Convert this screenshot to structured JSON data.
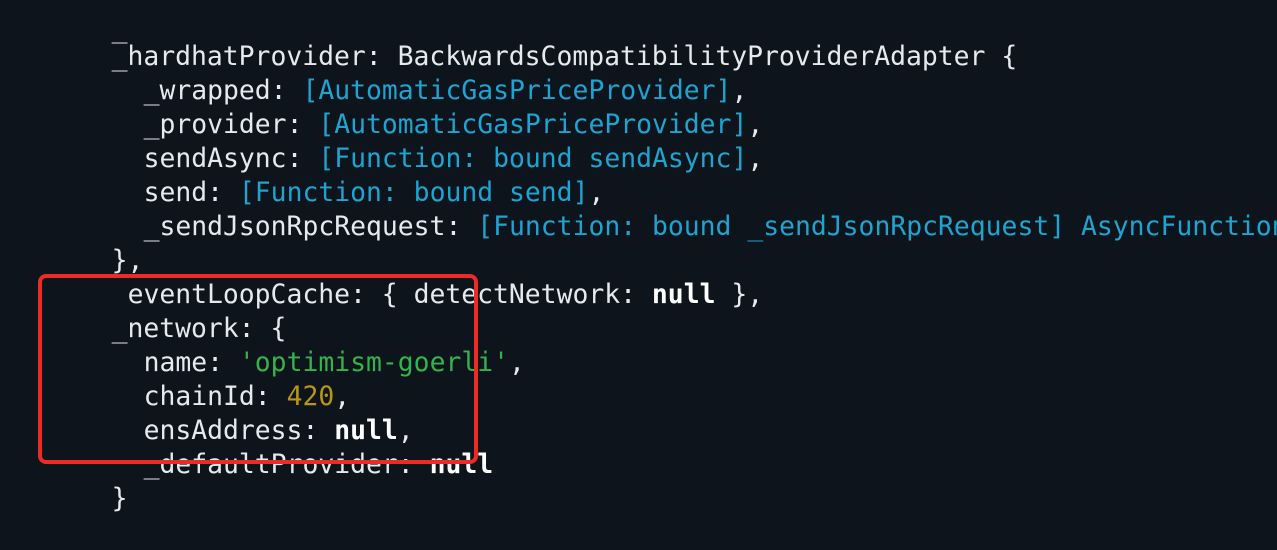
{
  "lines": {
    "l0": {
      "text": "_"
    },
    "l1": {
      "key": "_hardhatProvider",
      "sep": ": ",
      "value": "BackwardsCompatibilityProviderAdapter",
      "tail": " {"
    },
    "l2": {
      "key": "_wrapped",
      "sep": ": ",
      "value": "[AutomaticGasPriceProvider]",
      "tail": ","
    },
    "l3": {
      "key": "_provider",
      "sep": ": ",
      "value": "[AutomaticGasPriceProvider]",
      "tail": ","
    },
    "l4": {
      "key": "sendAsync",
      "sep": ": ",
      "value": "[Function: bound sendAsync]",
      "tail": ","
    },
    "l5": {
      "key": "send",
      "sep": ": ",
      "value": "[Function: bound send]",
      "tail": ","
    },
    "l6": {
      "key": "_sendJsonRpcRequest",
      "sep": ": ",
      "value": "[Function: bound _sendJsonRpcRequest] AsyncFunction"
    },
    "l7": {
      "text": "},"
    },
    "l8": {
      "key": "eventLoopCache",
      "sep": ": { ",
      "inner_key": "detectNetwork",
      "inner_sep": ": ",
      "value": "null",
      "tail": " },"
    },
    "l9": {
      "key": "_network",
      "sep": ": {"
    },
    "l10": {
      "key": "name",
      "sep": ": ",
      "value": "'optimism-goerli'",
      "tail": ","
    },
    "l11": {
      "key": "chainId",
      "sep": ": ",
      "value": "420",
      "tail": ","
    },
    "l12": {
      "key": "ensAddress",
      "sep": ": ",
      "value": "null",
      "tail": ","
    },
    "l13": {
      "key": "_defaultProvider",
      "sep": ": ",
      "value": "null"
    },
    "l14": {
      "text": "}"
    }
  },
  "colors": {
    "background": "#0e141b",
    "text": "#e6e9ee",
    "cyan": "#1fa3d1",
    "string_green": "#35b24a",
    "number_yellow": "#b89419",
    "highlight_red": "#ee2a24"
  }
}
